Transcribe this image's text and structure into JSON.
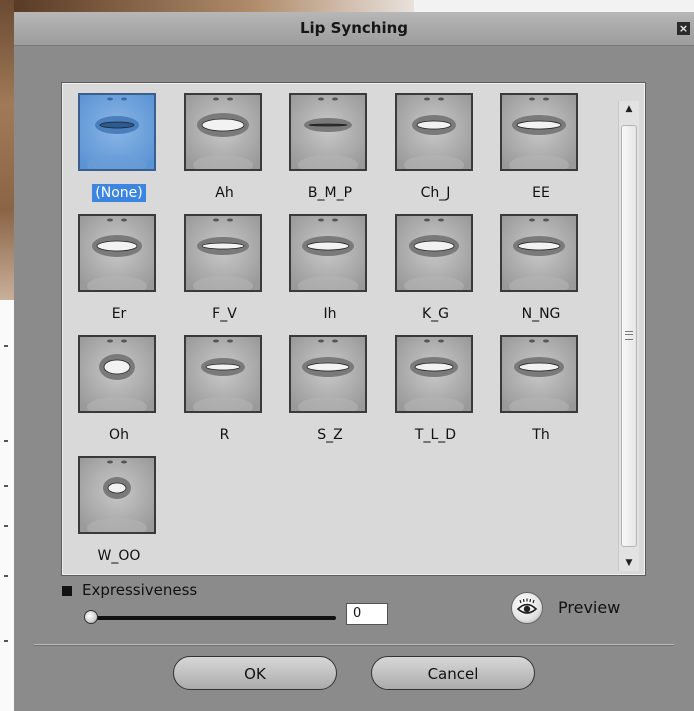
{
  "dialog": {
    "title": "Lip Synching",
    "close_symbol": "×"
  },
  "visemes": [
    {
      "label": "(None)",
      "selected": true
    },
    {
      "label": "Ah",
      "selected": false
    },
    {
      "label": "B_M_P",
      "selected": false
    },
    {
      "label": "Ch_J",
      "selected": false
    },
    {
      "label": "EE",
      "selected": false
    },
    {
      "label": "Er",
      "selected": false
    },
    {
      "label": "F_V",
      "selected": false
    },
    {
      "label": "Ih",
      "selected": false
    },
    {
      "label": "K_G",
      "selected": false
    },
    {
      "label": "N_NG",
      "selected": false
    },
    {
      "label": "Oh",
      "selected": false
    },
    {
      "label": "R",
      "selected": false
    },
    {
      "label": "S_Z",
      "selected": false
    },
    {
      "label": "T_L_D",
      "selected": false
    },
    {
      "label": "Th",
      "selected": false
    },
    {
      "label": "W_OO",
      "selected": false
    }
  ],
  "expressiveness": {
    "label": "Expressiveness",
    "value": "0"
  },
  "preview": {
    "label": "Preview",
    "icon": "eye-icon"
  },
  "buttons": {
    "ok": "OK",
    "cancel": "Cancel"
  },
  "colors": {
    "selection": "#3c85e0",
    "dialog_bg": "#8b8b8b",
    "panel_bg": "#d9d9d9"
  }
}
